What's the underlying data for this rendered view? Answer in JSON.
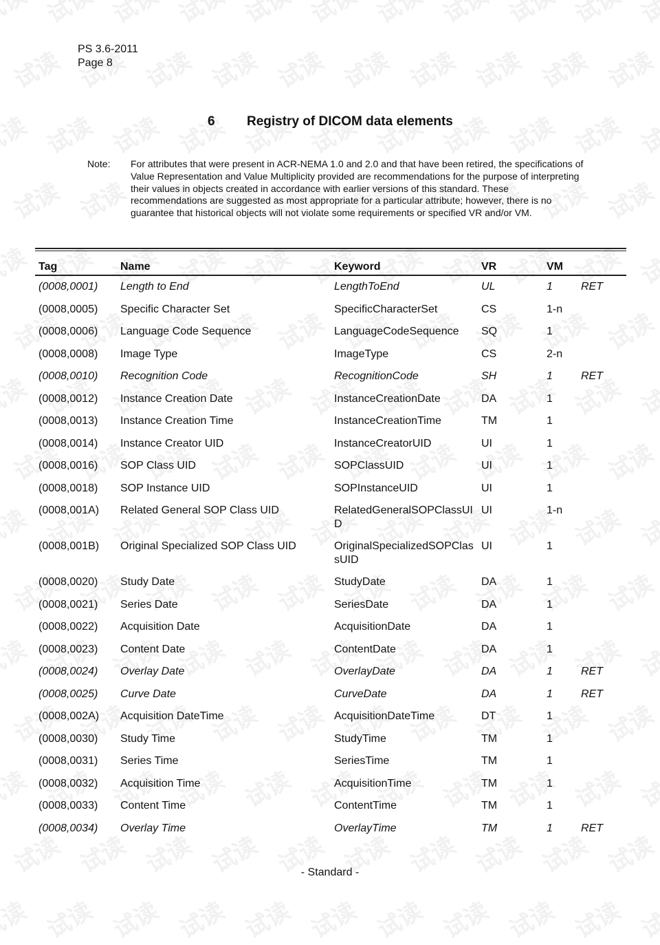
{
  "header": {
    "doc_id": "PS 3.6-2011",
    "page": "Page 8"
  },
  "section": {
    "number": "6",
    "title": "Registry of DICOM data elements"
  },
  "note": {
    "label": "Note:",
    "text": "For attributes that were present in ACR-NEMA 1.0 and 2.0 and that have been retired, the specifications of Value Representation and Value Multiplicity provided are recommendations for the purpose of interpreting their values in objects created in accordance with earlier versions of this standard. These recommendations are suggested as most appropriate for a particular attribute; however, there is no guarantee that historical objects will not violate some requirements or specified VR and/or VM."
  },
  "table": {
    "columns": [
      "Tag",
      "Name",
      "Keyword",
      "VR",
      "VM"
    ],
    "rows": [
      {
        "tag": "(0008,0001)",
        "name": "Length to End",
        "keyword": "LengthToEnd",
        "vr": "UL",
        "vm": "1",
        "ret": "RET"
      },
      {
        "tag": "(0008,0005)",
        "name": "Specific Character Set",
        "keyword": "SpecificCharacterSet",
        "vr": "CS",
        "vm": "1-n",
        "ret": ""
      },
      {
        "tag": "(0008,0006)",
        "name": "Language Code Sequence",
        "keyword": "LanguageCodeSequence",
        "vr": "SQ",
        "vm": "1",
        "ret": ""
      },
      {
        "tag": "(0008,0008)",
        "name": "Image Type",
        "keyword": "ImageType",
        "vr": "CS",
        "vm": "2-n",
        "ret": ""
      },
      {
        "tag": "(0008,0010)",
        "name": "Recognition Code",
        "keyword": "RecognitionCode",
        "vr": "SH",
        "vm": "1",
        "ret": "RET"
      },
      {
        "tag": "(0008,0012)",
        "name": "Instance Creation Date",
        "keyword": "InstanceCreationDate",
        "vr": "DA",
        "vm": "1",
        "ret": ""
      },
      {
        "tag": "(0008,0013)",
        "name": "Instance Creation Time",
        "keyword": "InstanceCreationTime",
        "vr": "TM",
        "vm": "1",
        "ret": ""
      },
      {
        "tag": "(0008,0014)",
        "name": "Instance Creator UID",
        "keyword": "InstanceCreatorUID",
        "vr": "UI",
        "vm": "1",
        "ret": ""
      },
      {
        "tag": "(0008,0016)",
        "name": "SOP Class UID",
        "keyword": "SOPClassUID",
        "vr": "UI",
        "vm": "1",
        "ret": ""
      },
      {
        "tag": "(0008,0018)",
        "name": "SOP Instance UID",
        "keyword": "SOPInstanceUID",
        "vr": "UI",
        "vm": "1",
        "ret": ""
      },
      {
        "tag": "(0008,001A)",
        "name": "Related General SOP Class UID",
        "keyword": "RelatedGeneralSOPClassUID",
        "vr": "UI",
        "vm": "1-n",
        "ret": ""
      },
      {
        "tag": "(0008,001B)",
        "name": "Original Specialized SOP Class UID",
        "keyword": "OriginalSpecializedSOPClassUID",
        "vr": "UI",
        "vm": "1",
        "ret": ""
      },
      {
        "tag": "(0008,0020)",
        "name": "Study Date",
        "keyword": "StudyDate",
        "vr": "DA",
        "vm": "1",
        "ret": ""
      },
      {
        "tag": "(0008,0021)",
        "name": "Series Date",
        "keyword": "SeriesDate",
        "vr": "DA",
        "vm": "1",
        "ret": ""
      },
      {
        "tag": "(0008,0022)",
        "name": "Acquisition Date",
        "keyword": "AcquisitionDate",
        "vr": "DA",
        "vm": "1",
        "ret": ""
      },
      {
        "tag": "(0008,0023)",
        "name": "Content Date",
        "keyword": "ContentDate",
        "vr": "DA",
        "vm": "1",
        "ret": ""
      },
      {
        "tag": "(0008,0024)",
        "name": "Overlay Date",
        "keyword": "OverlayDate",
        "vr": "DA",
        "vm": "1",
        "ret": "RET"
      },
      {
        "tag": "(0008,0025)",
        "name": "Curve Date",
        "keyword": "CurveDate",
        "vr": "DA",
        "vm": "1",
        "ret": "RET"
      },
      {
        "tag": "(0008,002A)",
        "name": "Acquisition DateTime",
        "keyword": "AcquisitionDateTime",
        "vr": "DT",
        "vm": "1",
        "ret": ""
      },
      {
        "tag": "(0008,0030)",
        "name": "Study Time",
        "keyword": "StudyTime",
        "vr": "TM",
        "vm": "1",
        "ret": ""
      },
      {
        "tag": "(0008,0031)",
        "name": "Series Time",
        "keyword": "SeriesTime",
        "vr": "TM",
        "vm": "1",
        "ret": ""
      },
      {
        "tag": "(0008,0032)",
        "name": "Acquisition Time",
        "keyword": "AcquisitionTime",
        "vr": "TM",
        "vm": "1",
        "ret": ""
      },
      {
        "tag": "(0008,0033)",
        "name": "Content Time",
        "keyword": "ContentTime",
        "vr": "TM",
        "vm": "1",
        "ret": ""
      },
      {
        "tag": "(0008,0034)",
        "name": "Overlay Time",
        "keyword": "OverlayTime",
        "vr": "TM",
        "vm": "1",
        "ret": "RET"
      }
    ]
  },
  "footer": {
    "text": "- Standard -"
  },
  "watermark": {
    "text": "试读"
  }
}
